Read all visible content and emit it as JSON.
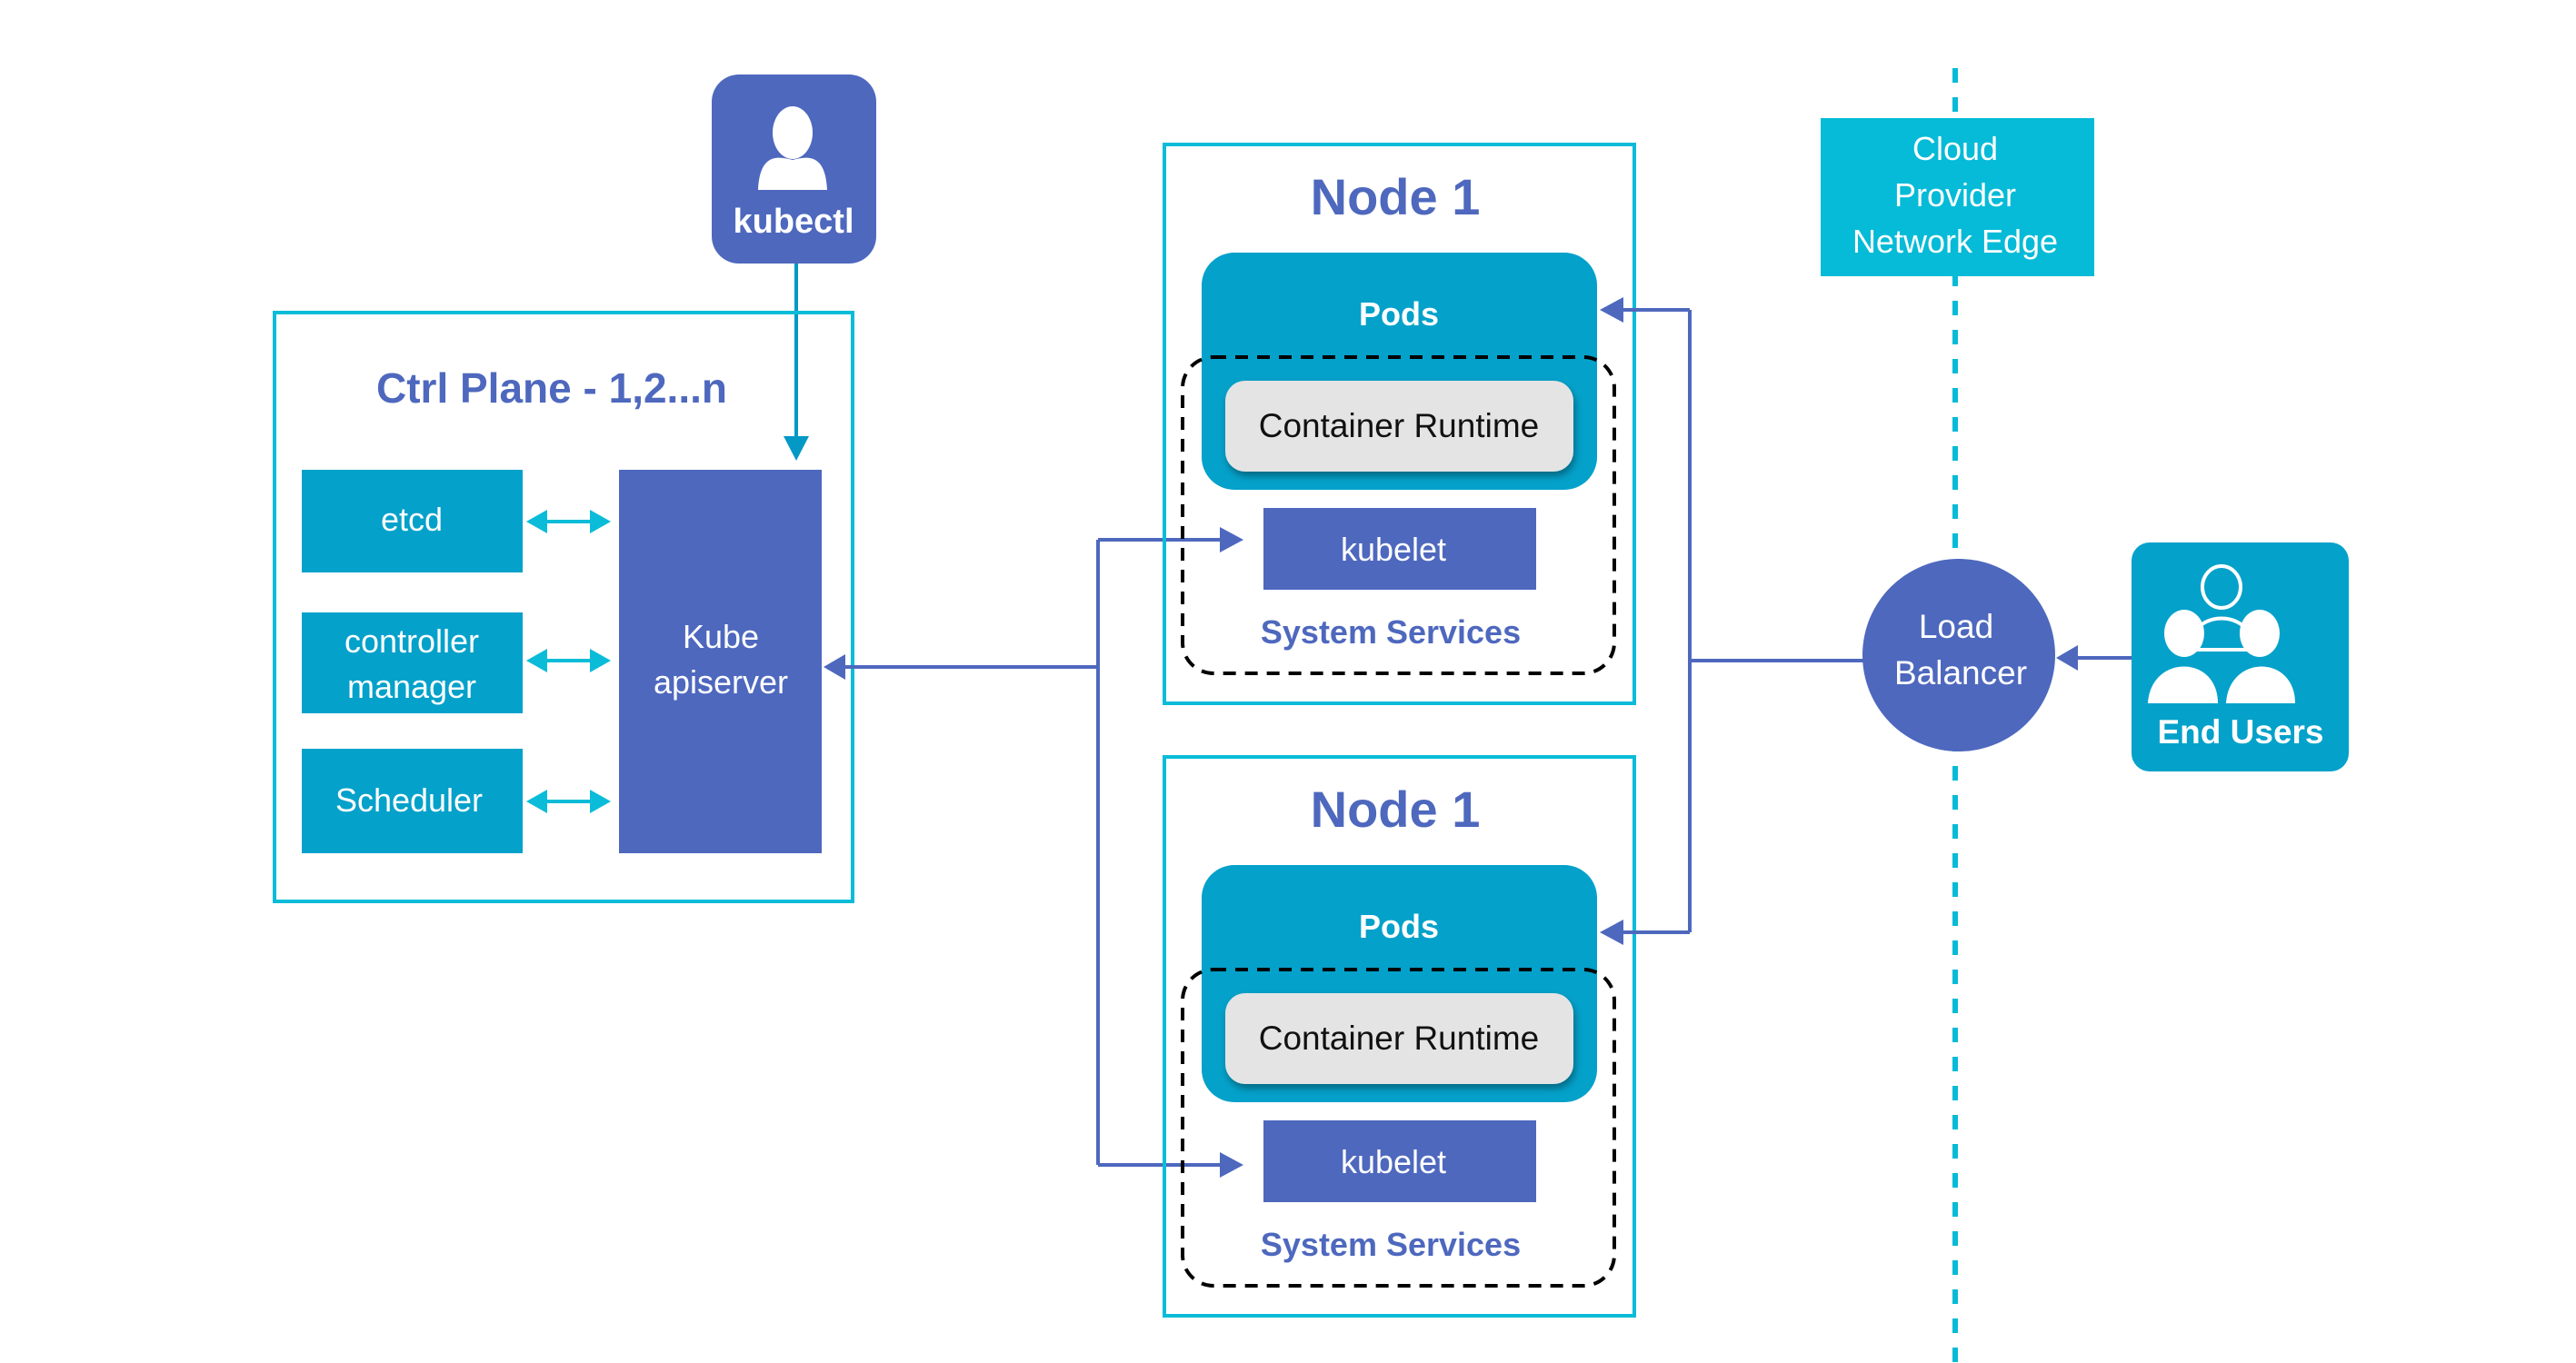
{
  "colors": {
    "cyan_border": "#0ABCD8",
    "box_blue": "#04A1CA",
    "indigo": "#4E68BE",
    "cloud_cyan": "#05BBD7",
    "runtime_gray": "#E4E4E4"
  },
  "kubectl": {
    "label": "kubectl",
    "icon": "user-icon"
  },
  "control_plane": {
    "title": "Ctrl Plane - 1,2...n",
    "components": [
      {
        "lines": [
          "etcd"
        ]
      },
      {
        "lines": [
          "controller",
          "manager"
        ]
      },
      {
        "lines": [
          "Scheduler"
        ]
      }
    ],
    "apiserver": {
      "lines": [
        "Kube",
        "apiserver"
      ]
    }
  },
  "nodes": [
    {
      "title": "Node 1",
      "pods_label": "Pods",
      "runtime_label": "Container Runtime",
      "kubelet_label": "kubelet",
      "system_services_label": "System Services"
    },
    {
      "title": "Node 1",
      "pods_label": "Pods",
      "runtime_label": "Container Runtime",
      "kubelet_label": "kubelet",
      "system_services_label": "System Services"
    }
  ],
  "cloud_edge": {
    "lines": [
      "Cloud",
      "Provider",
      "Network Edge"
    ]
  },
  "load_balancer": {
    "lines": [
      "Load",
      "Balancer"
    ]
  },
  "end_users": {
    "label": "End Users",
    "icon": "users-group-icon"
  }
}
